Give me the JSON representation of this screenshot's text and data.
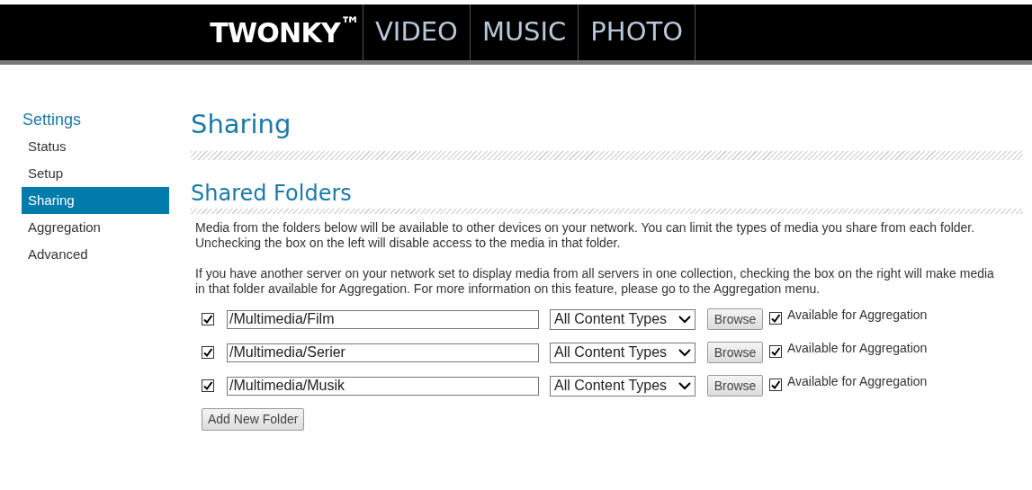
{
  "header": {
    "logo": "TWONKY$^{™}$",
    "tabs": [
      {
        "label": "VIDEO",
        "selected": false
      },
      {
        "label": "MUSIC",
        "selected": false
      },
      {
        "label": "PHOTO",
        "selected": false
      }
    ]
  },
  "sidebar": {
    "title": "Settings",
    "items": [
      {
        "label": "Status",
        "selected": false
      },
      {
        "label": "Setup",
        "selected": false
      },
      {
        "label": "Sharing",
        "selected": true
      },
      {
        "label": "Aggregation",
        "selected": false
      },
      {
        "label": "Advanced",
        "selected": false
      }
    ]
  },
  "page_title": "Sharing",
  "section_title": "Shared Folders",
  "paragraphs": [
    "Media from the folders below will be available to other devices on your network. You can limit the types of media you share from each folder. Unchecking the box on the left will disable access to the media in that folder.",
    "If you have another server on your network set to display media from all servers in one collection, checking the box on the right will make media in that folder available for Aggregation. For more information on this feature, please go to the Aggregation menu."
  ],
  "folders": [
    {
      "checked": true,
      "path": "/Multimedia/Film",
      "content_type": "All Content Types",
      "browse": "Browse",
      "aggregation_checked": true,
      "aggregation_label": "Available for Aggregation"
    },
    {
      "checked": true,
      "path": "/Multimedia/Serier",
      "content_type": "All Content Types",
      "browse": "Browse",
      "aggregation_checked": true,
      "aggregation_label": "Available for Aggregation"
    },
    {
      "checked": true,
      "path": "/Multimedia/Musik",
      "content_type": "All Content Types",
      "browse": "Browse",
      "aggregation_checked": true,
      "aggregation_label": "Available for Aggregation"
    }
  ],
  "add_button": "Add New Folder"
}
